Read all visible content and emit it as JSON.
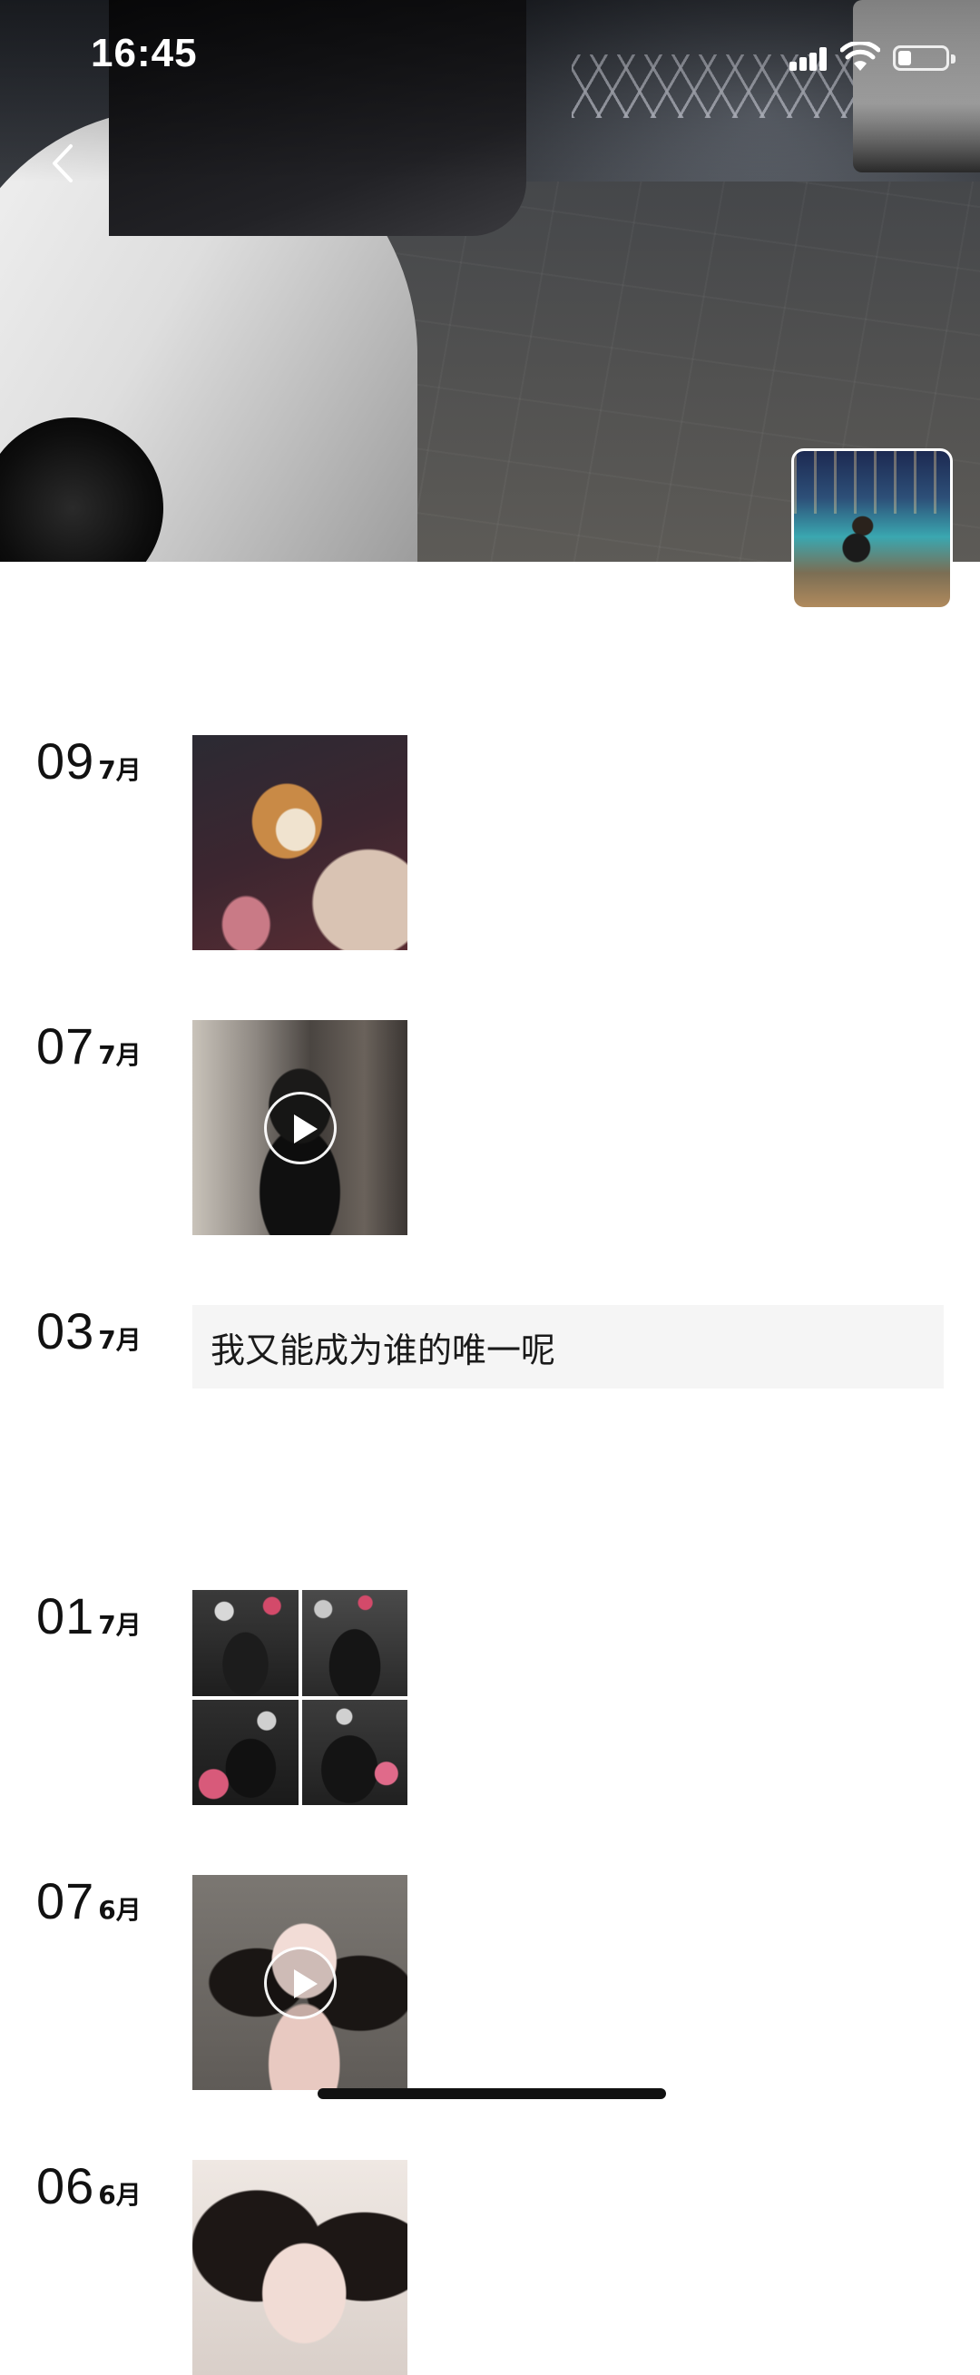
{
  "status_bar": {
    "time": "16:45",
    "icons": [
      "signal-icon",
      "wifi-icon",
      "battery-icon"
    ]
  },
  "header": {
    "back_icon": "chevron-left-icon",
    "cover_description": "cover-photo",
    "avatar": "avatar"
  },
  "posts": [
    {
      "day": "09",
      "month": "7月",
      "type": "photo",
      "media": [
        "photo"
      ]
    },
    {
      "day": "07",
      "month": "7月",
      "type": "video",
      "media": [
        "video"
      ]
    },
    {
      "day": "03",
      "month": "7月",
      "type": "text",
      "text": "我又能成为谁的唯一呢"
    },
    {
      "day": "01",
      "month": "7月",
      "type": "photo-grid",
      "media": [
        "photo",
        "photo",
        "photo",
        "photo"
      ]
    },
    {
      "day": "07",
      "month": "6月",
      "type": "video",
      "media": [
        "video"
      ]
    },
    {
      "day": "06",
      "month": "6月",
      "type": "photo",
      "media": [
        "photo"
      ]
    }
  ],
  "colors": {
    "text_primary": "#111111",
    "text_card_bg": "#f5f5f5",
    "background": "#ffffff"
  }
}
